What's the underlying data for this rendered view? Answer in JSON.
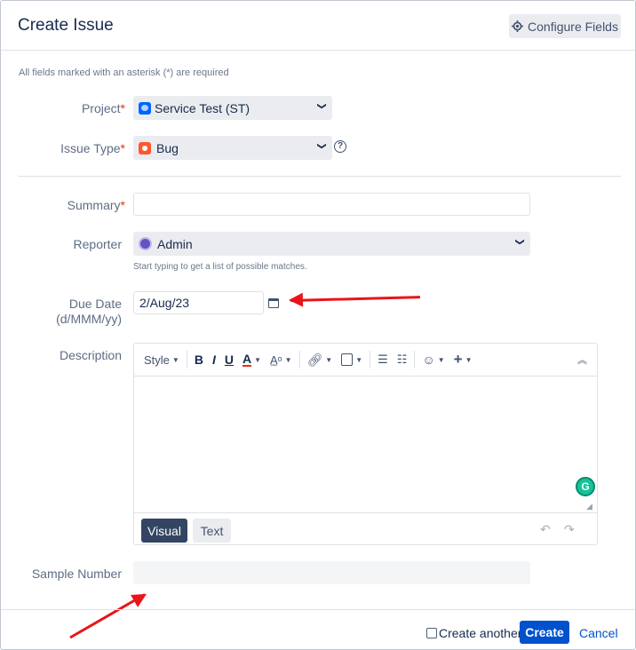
{
  "dialog": {
    "title": "Create Issue",
    "configure_fields_label": "Configure Fields",
    "required_note": "All fields marked with an asterisk (*) are required"
  },
  "fields": {
    "project": {
      "label": "Project",
      "value": "Service Test (ST)"
    },
    "issue_type": {
      "label": "Issue Type",
      "value": "Bug"
    },
    "summary": {
      "label": "Summary",
      "value": ""
    },
    "reporter": {
      "label": "Reporter",
      "value": "Admin",
      "hint": "Start typing to get a list of possible matches."
    },
    "due_date": {
      "label": "Due Date",
      "format": "(d/MMM/yy)",
      "value": "2/Aug/23"
    },
    "description": {
      "label": "Description"
    },
    "sample_number": {
      "label": "Sample Number",
      "value": ""
    }
  },
  "editor": {
    "style_label": "Style",
    "bold": "B",
    "italic": "I",
    "underline": "U",
    "text_color": "A",
    "visual_tab": "Visual",
    "text_tab": "Text"
  },
  "footer": {
    "create_another_label": "Create another",
    "create_label": "Create",
    "cancel_label": "Cancel"
  },
  "colors": {
    "primary": "#0052cc",
    "required": "#de350b",
    "annotation_arrow": "#e8151a"
  },
  "icons": [
    "gear-icon",
    "project-avatar-icon",
    "bug-icon",
    "help-icon",
    "user-avatar-icon",
    "calendar-icon",
    "grammarly-icon",
    "chevron-down-icon"
  ]
}
